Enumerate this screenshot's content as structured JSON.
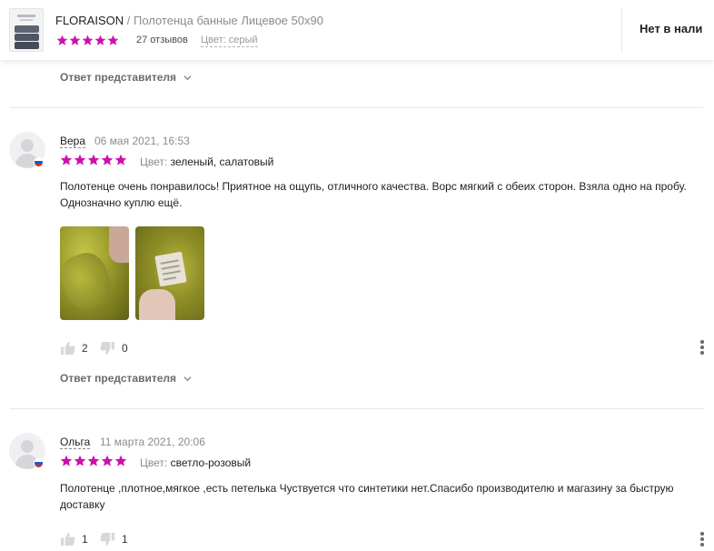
{
  "header": {
    "brand": "FLORAISON",
    "separator": " / ",
    "product_name": "Полотенца банные Лицевое 50x90",
    "rating_stars": 5,
    "reviews_count": "27 отзывов",
    "color": "Цвет: серый",
    "stock_status": "Нет в нали"
  },
  "rep_label": "Ответ представителя",
  "reviews": [
    {
      "author": "Вера",
      "date": "06 мая 2021, 16:53",
      "stars": 5,
      "color_label": "Цвет:",
      "color_value": "зеленый, салатовый",
      "text": "Полотенце очень понравилось! Приятное на ощупь, отличного качества. Ворс мягкий с обеих сторон. Взяла одно на пробу. Однозначно куплю ещё.",
      "likes": "2",
      "dislikes": "0",
      "photos": 2
    },
    {
      "author": "Ольга",
      "date": "11 марта 2021, 20:06",
      "stars": 5,
      "color_label": "Цвет:",
      "color_value": "светло-розовый",
      "text": "Полотенце ,плотное,мягкое ,есть петелька Чуствуется что синтетики нет.Спасибо производителю и магазину за быструю доставку",
      "likes": "1",
      "dislikes": "1"
    }
  ],
  "colors": {
    "star": "#cb11ab",
    "text": "#1f1f1f",
    "muted": "#8b8b8b",
    "separator": "#e8e8e8"
  },
  "icons": [
    "star-icon",
    "chevron-down-icon",
    "thumbs-up-icon",
    "thumbs-down-icon",
    "more-vertical-icon",
    "avatar-placeholder-icon",
    "russia-flag-icon"
  ]
}
